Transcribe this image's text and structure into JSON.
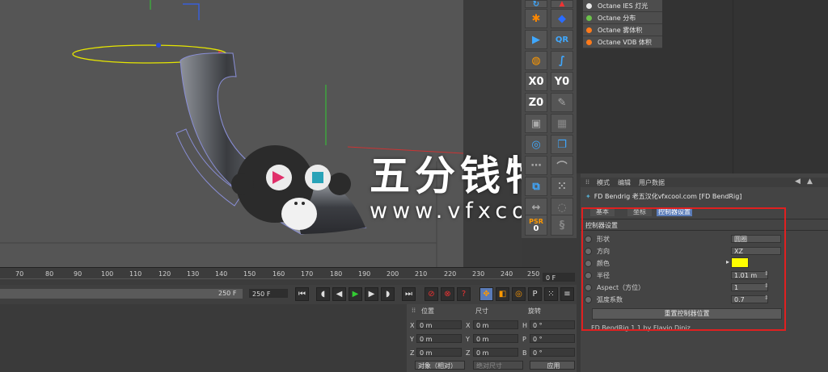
{
  "octane_list": [
    {
      "label": "Octane IES 灯光",
      "color": "#e8e8e8"
    },
    {
      "label": "Octane 分布",
      "color": "#6cc24a"
    },
    {
      "label": "Octane 雾体积",
      "color": "#ff7a1a"
    },
    {
      "label": "Octane VDB 体积",
      "color": "#ff7a1a"
    }
  ],
  "palette": {
    "x0": "X0",
    "y0": "Y0",
    "z0": "Z0",
    "psr": "PSR",
    "psr_val": "0"
  },
  "attr": {
    "menu": [
      "模式",
      "编辑",
      "用户数据"
    ],
    "title": "FD Bendrig 老五汉化vfxcool.com [FD BendRig]",
    "tabs": [
      "基本",
      "坐标",
      "控制器设置"
    ],
    "section": "控制器设置",
    "rows": [
      {
        "label": "形状",
        "value": "圆圈"
      },
      {
        "label": "方向",
        "value": "XZ"
      },
      {
        "label": "颜色",
        "value": ""
      },
      {
        "label": "半径",
        "value": "1.01 m"
      },
      {
        "label": "Aspect（方位）",
        "value": "1"
      },
      {
        "label": "弧度系数",
        "value": "0.7"
      }
    ],
    "reset_button": "重置控制器位置",
    "footer": "FD BendRig 1.1 by Flavio Diniz",
    "swatch_color": "#ffff00"
  },
  "ruler": {
    "ticks": [
      "70",
      "80",
      "90",
      "100",
      "110",
      "120",
      "130",
      "140",
      "150",
      "160",
      "170",
      "180",
      "190",
      "200",
      "210",
      "220",
      "230",
      "240",
      "250"
    ],
    "suffix": "0 F",
    "frame_field": "0 F"
  },
  "transport": {
    "end_frame": "250 F",
    "end_frame_b": "250 F"
  },
  "coords": {
    "headers": [
      "位置",
      "尺寸",
      "旋转"
    ],
    "rows": [
      {
        "a": "X",
        "av": "0 m",
        "b": "X",
        "bv": "0 m",
        "c": "H",
        "cv": "0 °"
      },
      {
        "a": "Y",
        "av": "0 m",
        "b": "Y",
        "bv": "0 m",
        "c": "P",
        "cv": "0 °"
      },
      {
        "a": "Z",
        "av": "0 m",
        "b": "Z",
        "bv": "0 m",
        "c": "B",
        "cv": "0 °"
      }
    ],
    "mode": "对象（相对）",
    "size_mode": "绝对尺寸",
    "apply": "应用"
  },
  "watermark": {
    "cn": "五分钱特效",
    "url": "www.vfxcool.com"
  },
  "colors": {
    "highlight_box": "#e02020",
    "spline": "#e6e600",
    "tab_active": "#5a7bb8"
  }
}
